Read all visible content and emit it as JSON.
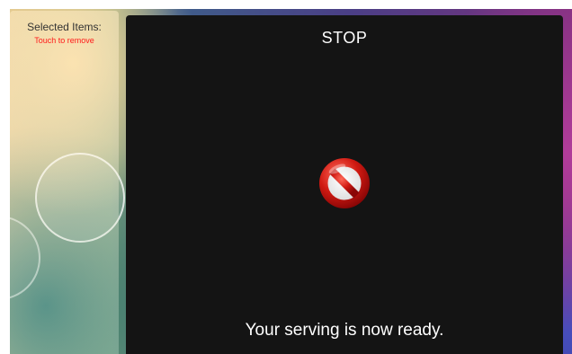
{
  "selected_panel": {
    "title": "Selected Items:",
    "hint": "Touch to remove",
    "hint_color": "#ff1a1a"
  },
  "status_panel": {
    "title": "STOP",
    "icon": "stop-icon",
    "message": "Your serving is now ready.",
    "background_color": "#141414"
  }
}
